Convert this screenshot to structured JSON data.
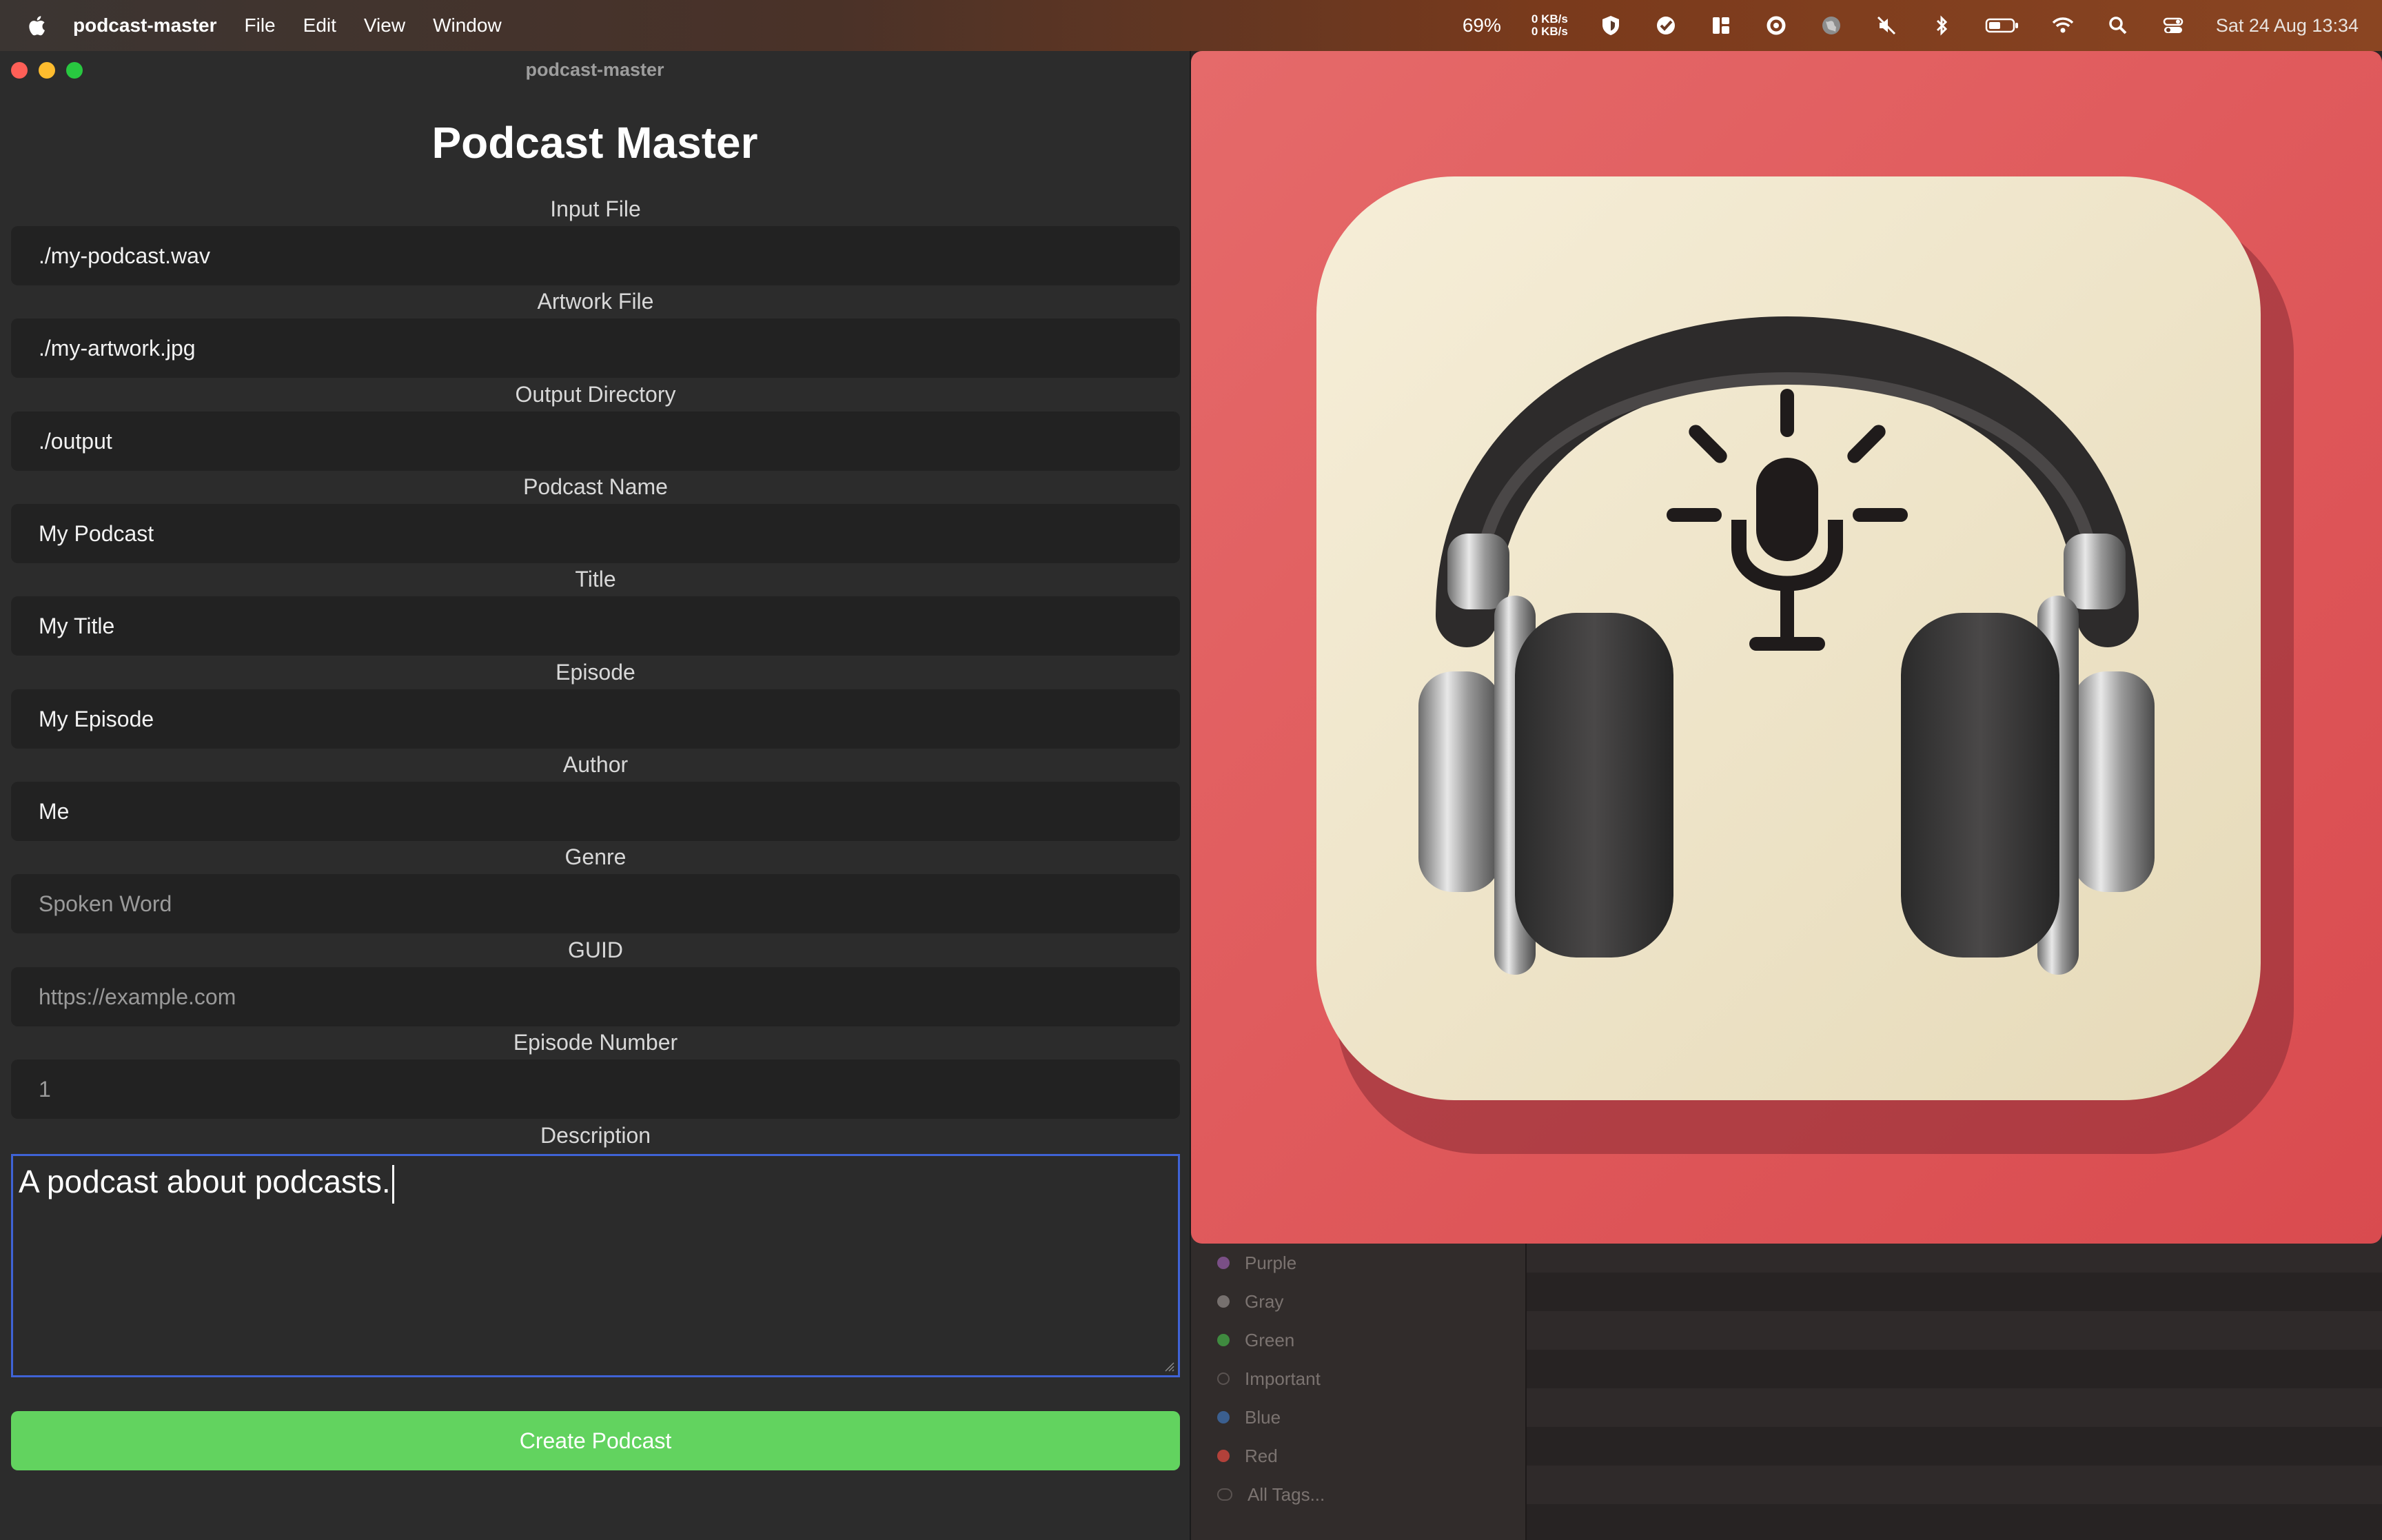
{
  "menubar": {
    "app_name": "podcast-master",
    "menus": [
      "File",
      "Edit",
      "View",
      "Window"
    ],
    "battery_percent": "69%",
    "net_up": "0 KB/s",
    "net_down": "0 KB/s",
    "datetime": "Sat 24 Aug  13:34"
  },
  "window": {
    "title": "podcast-master",
    "heading": "Podcast Master"
  },
  "form": {
    "fields": [
      {
        "label": "Input File",
        "value": "./my-podcast.wav",
        "placeholder": false
      },
      {
        "label": "Artwork File",
        "value": "./my-artwork.jpg",
        "placeholder": false
      },
      {
        "label": "Output Directory",
        "value": "./output",
        "placeholder": false
      },
      {
        "label": "Podcast Name",
        "value": "My Podcast",
        "placeholder": false
      },
      {
        "label": "Title",
        "value": "My Title",
        "placeholder": false
      },
      {
        "label": "Episode",
        "value": "My Episode",
        "placeholder": false
      },
      {
        "label": "Author",
        "value": "Me",
        "placeholder": false
      },
      {
        "label": "Genre",
        "value": "Spoken Word",
        "placeholder": true
      },
      {
        "label": "GUID",
        "value": "https://example.com",
        "placeholder": true
      },
      {
        "label": "Episode Number",
        "value": "1",
        "placeholder": true
      }
    ],
    "description_label": "Description",
    "description_value": "A podcast about podcasts.",
    "submit_label": "Create Podcast"
  },
  "finder_tags": [
    {
      "label": "Purple",
      "color": "#7a4f86"
    },
    {
      "label": "Gray",
      "color": "#76706e"
    },
    {
      "label": "Green",
      "color": "#3f8a3f"
    },
    {
      "label": "Important",
      "color": "none"
    },
    {
      "label": "Blue",
      "color": "#3b5f8f"
    },
    {
      "label": "Red",
      "color": "#b2413a"
    },
    {
      "label": "All Tags...",
      "color": "none"
    }
  ],
  "colors": {
    "accent_green": "#62d35f",
    "focus_blue": "#3f63d6",
    "artwork_background": "#e05b5d",
    "artwork_tile": "#efe5cc"
  }
}
